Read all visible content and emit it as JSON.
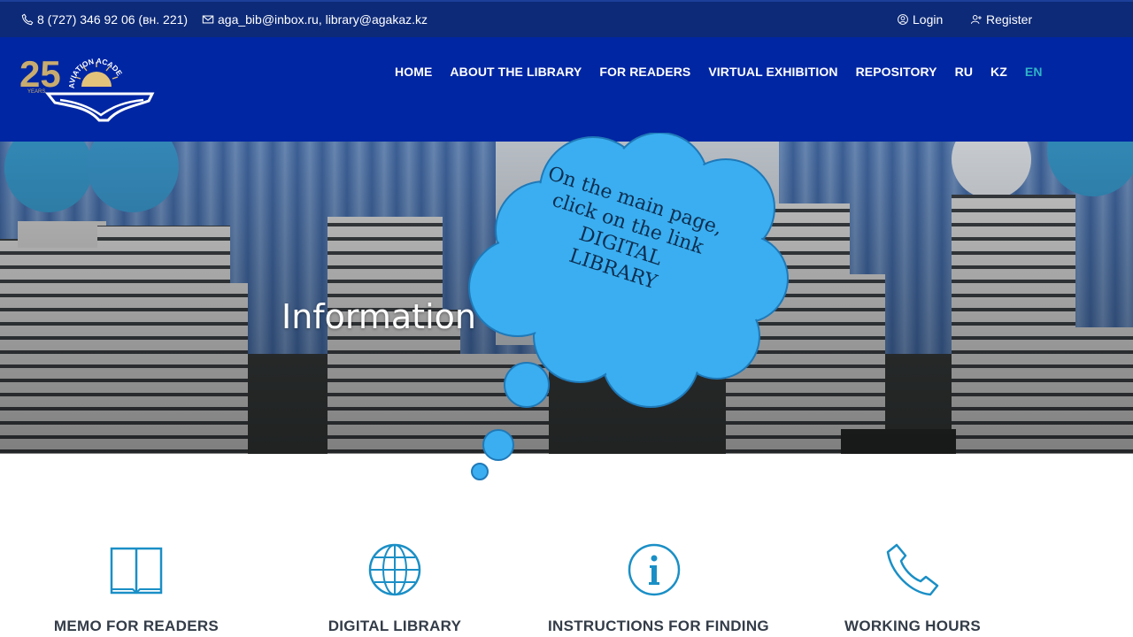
{
  "topbar": {
    "phone": "8 (727) 346 92 06 (вн. 221)",
    "email": "aga_bib@inbox.ru, library@agakaz.kz",
    "login": "Login",
    "register": "Register"
  },
  "logo": {
    "number": "25",
    "years": "YEARS",
    "text": "AVIATION ACADEMY"
  },
  "nav": {
    "items": [
      "HOME",
      "ABOUT THE LIBRARY",
      "FOR READERS",
      "VIRTUAL EXHIBITION",
      "REPOSITORY",
      "RU",
      "KZ",
      "EN"
    ]
  },
  "hero": {
    "title": "Information a"
  },
  "callout": {
    "lines": [
      "On the main page,",
      "click on the link",
      "DIGITAL",
      "LIBRARY"
    ]
  },
  "features": [
    {
      "title": "MEMO FOR READERS",
      "icon": "book-icon"
    },
    {
      "title": "DIGITAL LIBRARY",
      "icon": "globe-icon"
    },
    {
      "title": "INSTRUCTIONS FOR FINDING",
      "icon": "info-icon"
    },
    {
      "title": "WORKING HOURS",
      "icon": "phone-icon"
    }
  ],
  "colors": {
    "topbar": "#0d2a78",
    "header": "#0026a3",
    "accent": "#2fb4c6",
    "icon": "#1a8fc6",
    "cloud": "#3aaef0"
  }
}
